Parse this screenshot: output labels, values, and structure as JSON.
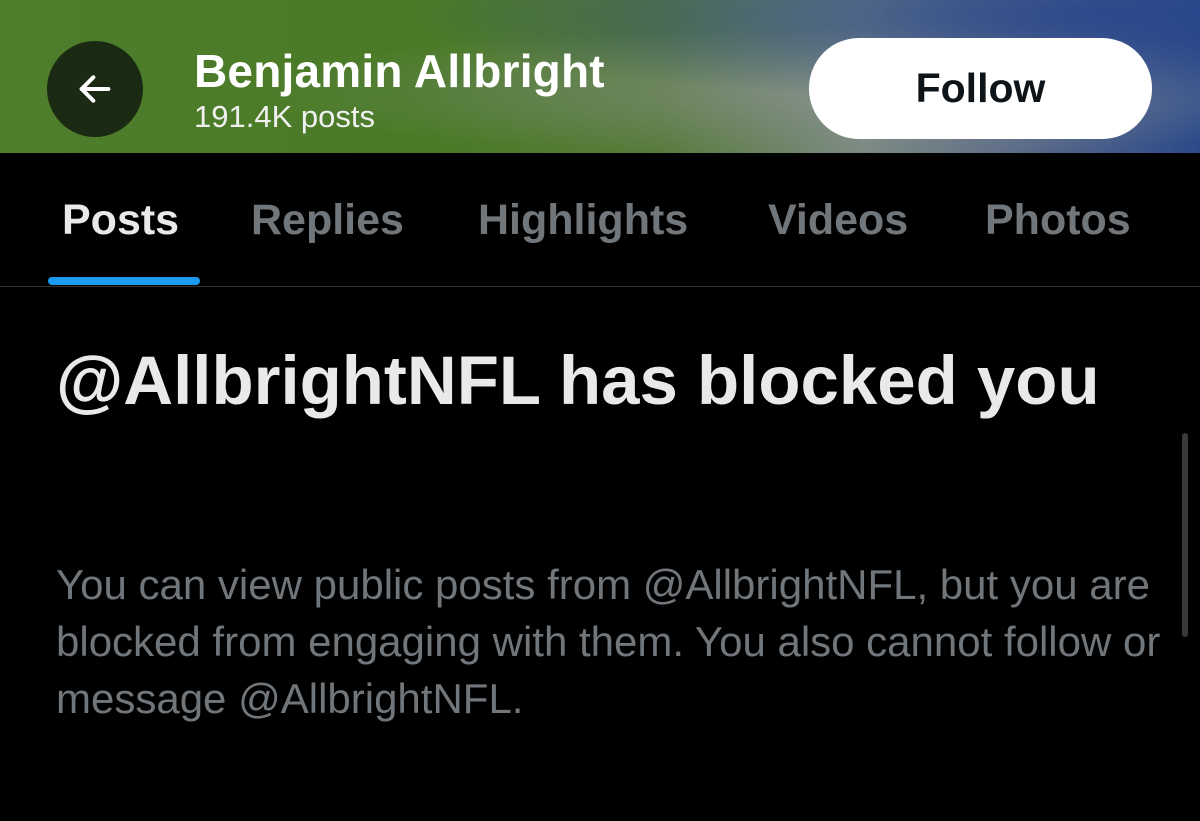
{
  "header": {
    "profile_name": "Benjamin Allbright",
    "post_count": "191.4K posts",
    "follow_label": "Follow",
    "back_icon": "arrow-left-icon"
  },
  "tabs": [
    {
      "label": "Posts",
      "active": true
    },
    {
      "label": "Replies",
      "active": false
    },
    {
      "label": "Highlights",
      "active": false
    },
    {
      "label": "Videos",
      "active": false
    },
    {
      "label": "Photos",
      "active": false
    }
  ],
  "blocked": {
    "title": "@AllbrightNFL has blocked you",
    "description": "You can view public posts from @AllbrightNFL, but you are blocked from engaging with them. You also cannot follow or message @AllbrightNFL."
  },
  "colors": {
    "background": "#000000",
    "accent": "#1d9bf0",
    "primary_text": "#e7e9ea",
    "secondary_text": "#71767b"
  }
}
